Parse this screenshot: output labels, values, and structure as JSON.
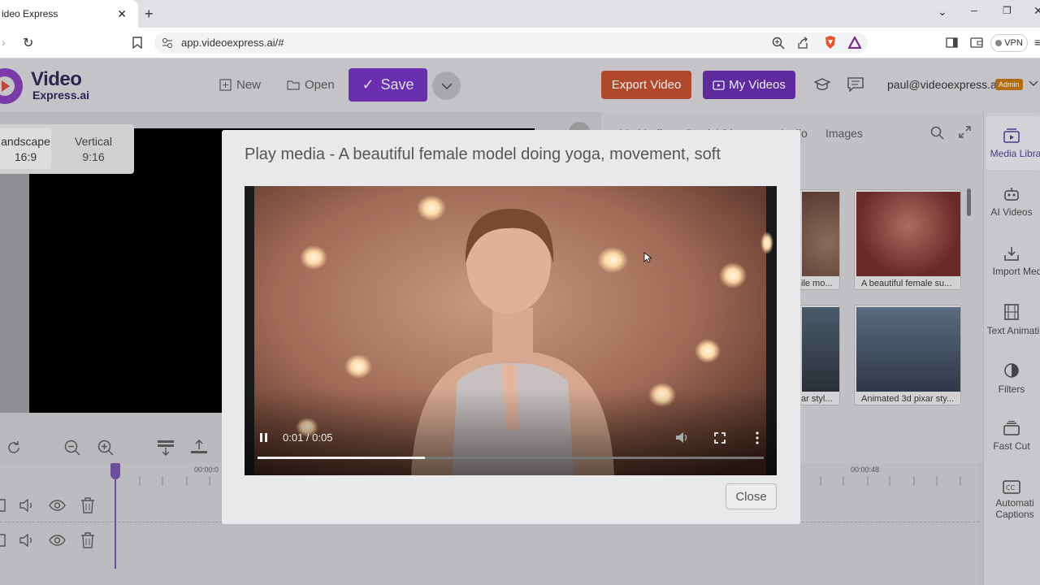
{
  "browser": {
    "tab_title": "ideo Express",
    "url": "app.videoexpress.ai/#",
    "vpn_label": "VPN"
  },
  "header": {
    "logo_line1": "Video",
    "logo_line2": "Express.ai",
    "new_label": "New",
    "open_label": "Open",
    "save_label": "Save",
    "export_label": "Export Video",
    "myvideos_label": "My Videos",
    "user_email": "paul@videoexpress.ai",
    "role_badge": "Admin"
  },
  "ratios": [
    {
      "name": "andscape",
      "ratio": "16:9"
    },
    {
      "name": "Vertical",
      "ratio": "9:16"
    }
  ],
  "media_panel": {
    "tabs": [
      "My Media",
      "Stock Video",
      "Audio",
      "Images"
    ],
    "thumbs": [
      {
        "caption": "ile mo..."
      },
      {
        "caption": "A beautiful female su..."
      },
      {
        "caption": "ar styl..."
      },
      {
        "caption": "Animated 3d pixar sty..."
      }
    ]
  },
  "side_nav": [
    {
      "label": "Media Libra",
      "icon": "media-library-icon"
    },
    {
      "label": "AI Videos",
      "icon": "robot-icon"
    },
    {
      "label": "Import Med",
      "icon": "import-icon"
    },
    {
      "label": "Text Animati",
      "icon": "film-icon"
    },
    {
      "label": "Filters",
      "icon": "filter-icon"
    },
    {
      "label": "Fast Cut",
      "icon": "fast-cut-icon"
    },
    {
      "label": "Automatic Captions",
      "label_line1": "Automati",
      "label_line2": "Captions",
      "icon": "cc-icon"
    }
  ],
  "timeline": {
    "tick_left": "00:00:0",
    "tick_right": "00:00:48"
  },
  "modal": {
    "title": "Play media - A beautiful female model doing yoga, movement, soft",
    "time": "0:01 / 0:05",
    "progress": 0.33,
    "close_label": "Close"
  },
  "colors": {
    "save": "#6a2fb0",
    "export": "#b0492b",
    "myvideos": "#5e2a9e",
    "admin_badge": "#b46a10"
  }
}
